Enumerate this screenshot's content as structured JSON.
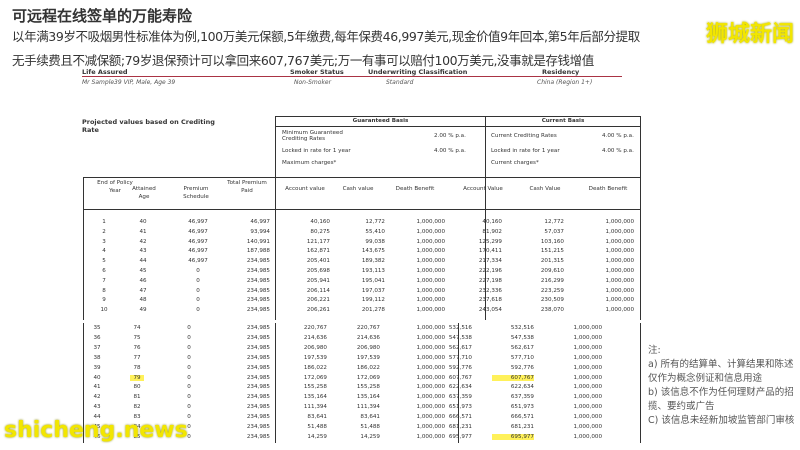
{
  "title": "可远程在线签单的万能寿险",
  "subtitle1": "以年满39岁不吸烟男性标准体为例,100万美元保额,5年缴费,每年保费46,997美元,现金价值9年回本,第5年后部分提取",
  "subtitle2": "无手续费且不减保额;79岁退保预计可以拿回来607,767美元;万一有事可以赔付100万美元,没事就是存钱增值",
  "logo": "狮城新闻",
  "watermark": "shicheng.news",
  "info": {
    "life_assured_label": "Life Assured",
    "life_assured": "Mr Sample39 VIP, Male, Age 39",
    "smoker_label": "Smoker Status",
    "smoker": "Non-Smoker",
    "uw_label": "Underwriting Classification",
    "uw": "Standard",
    "residency_label": "Residency",
    "residency": "China (Region 1+)"
  },
  "table": {
    "projected_label": "Projected values based on Crediting Rate",
    "guaranteed": {
      "title": "Guaranteed Basis",
      "r1_label": "Minimum Guaranteed Crediting Rates",
      "r1_value": "2.00 % p.a.",
      "r2_label": "Locked in rate for 1 year",
      "r2_value": "4.00 % p.a.",
      "r3_label": "Maximum charges*"
    },
    "current": {
      "title": "Current Basis",
      "r1_label": "Current Crediting Rates",
      "r1_value": "4.00 % p.a.",
      "r2_label": "Locked in rate for 1 year",
      "r2_value": "4.00 % p.a.",
      "r3_label": "Current charges*"
    },
    "columns": [
      "End of Policy Year",
      "Attained Age",
      "Premium Schedule",
      "Total Premium Paid",
      "Account value",
      "Cash value",
      "Death Benefit",
      "Account Value",
      "Cash Value",
      "Death Benefit"
    ],
    "rows_a": [
      [
        "1",
        "40",
        "46,997",
        "46,997",
        "40,160",
        "12,772",
        "1,000,000",
        "40,160",
        "12,772",
        "1,000,000"
      ],
      [
        "2",
        "41",
        "46,997",
        "93,994",
        "80,275",
        "55,410",
        "1,000,000",
        "81,902",
        "57,037",
        "1,000,000"
      ],
      [
        "3",
        "42",
        "46,997",
        "140,991",
        "121,177",
        "99,038",
        "1,000,000",
        "125,299",
        "103,160",
        "1,000,000"
      ],
      [
        "4",
        "43",
        "46,997",
        "187,988",
        "162,871",
        "143,675",
        "1,000,000",
        "170,411",
        "151,215",
        "1,000,000"
      ],
      [
        "5",
        "44",
        "46,997",
        "234,985",
        "205,401",
        "189,382",
        "1,000,000",
        "217,334",
        "201,315",
        "1,000,000"
      ],
      [
        "6",
        "45",
        "0",
        "234,985",
        "205,698",
        "193,113",
        "1,000,000",
        "222,196",
        "209,610",
        "1,000,000"
      ],
      [
        "7",
        "46",
        "0",
        "234,985",
        "205,941",
        "195,041",
        "1,000,000",
        "227,198",
        "216,299",
        "1,000,000"
      ],
      [
        "8",
        "47",
        "0",
        "234,985",
        "206,114",
        "197,037",
        "1,000,000",
        "232,336",
        "223,259",
        "1,000,000"
      ],
      [
        "9",
        "48",
        "0",
        "234,985",
        "206,221",
        "199,112",
        "1,000,000",
        "237,618",
        "230,509",
        "1,000,000"
      ],
      [
        "10",
        "49",
        "0",
        "234,985",
        "206,261",
        "201,278",
        "1,000,000",
        "243,054",
        "238,070",
        "1,000,000"
      ]
    ],
    "rows_b": [
      [
        "35",
        "74",
        "0",
        "234,985",
        "220,767",
        "220,767",
        "1,000,000",
        "532,516",
        "532,516",
        "1,000,000"
      ],
      [
        "36",
        "75",
        "0",
        "234,985",
        "214,636",
        "214,636",
        "1,000,000",
        "547,538",
        "547,538",
        "1,000,000"
      ],
      [
        "37",
        "76",
        "0",
        "234,985",
        "206,980",
        "206,980",
        "1,000,000",
        "562,617",
        "562,617",
        "1,000,000"
      ],
      [
        "38",
        "77",
        "0",
        "234,985",
        "197,539",
        "197,539",
        "1,000,000",
        "577,710",
        "577,710",
        "1,000,000"
      ],
      [
        "39",
        "78",
        "0",
        "234,985",
        "186,022",
        "186,022",
        "1,000,000",
        "592,776",
        "592,776",
        "1,000,000"
      ],
      [
        "40",
        "79",
        "0",
        "234,985",
        "172,069",
        "172,069",
        "1,000,000",
        "607,767",
        "607,767",
        "1,000,000"
      ],
      [
        "41",
        "80",
        "0",
        "234,985",
        "155,258",
        "155,258",
        "1,000,000",
        "622,634",
        "622,634",
        "1,000,000"
      ],
      [
        "42",
        "81",
        "0",
        "234,985",
        "135,164",
        "135,164",
        "1,000,000",
        "637,359",
        "637,359",
        "1,000,000"
      ],
      [
        "43",
        "82",
        "0",
        "234,985",
        "111,394",
        "111,394",
        "1,000,000",
        "651,973",
        "651,973",
        "1,000,000"
      ],
      [
        "44",
        "83",
        "0",
        "234,985",
        "83,641",
        "83,641",
        "1,000,000",
        "666,571",
        "666,571",
        "1,000,000"
      ],
      [
        "45",
        "84",
        "0",
        "234,985",
        "51,488",
        "51,488",
        "1,000,000",
        "681,231",
        "681,231",
        "1,000,000"
      ],
      [
        "46",
        "85",
        "0",
        "234,985",
        "14,259",
        "14,259",
        "1,000,000",
        "695,977",
        "695,977",
        "1,000,000"
      ]
    ],
    "highlight_color": "#fff15a"
  },
  "notes": [
    "注:",
    "a) 所有的结算单、计算结果和陈述仅作为概念例证和信息用途",
    "b) 该信息不作为任何理财产品的招揽、要约或广告",
    "C) 该信息未经新加坡监管部门审核"
  ]
}
